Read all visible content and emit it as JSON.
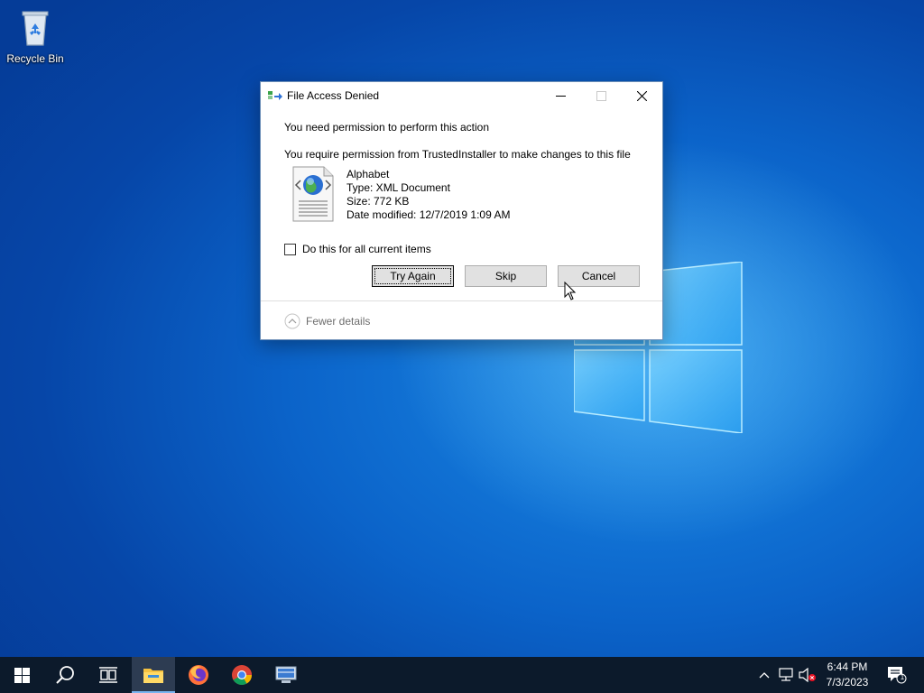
{
  "desktop": {
    "icons": [
      {
        "label": "Recycle Bin",
        "icon": "recycle-bin-icon"
      }
    ]
  },
  "dialog": {
    "title": "File Access Denied",
    "heading": "You need permission to perform this action",
    "message": "You require permission from TrustedInstaller to make changes to this file",
    "file": {
      "name": "Alphabet",
      "type": "Type: XML Document",
      "size": "Size: 772 KB",
      "modified": "Date modified: 12/7/2019 1:09 AM"
    },
    "checkbox_label": "Do this for all current items",
    "checkbox_checked": false,
    "buttons": {
      "try_again": "Try Again",
      "skip": "Skip",
      "cancel": "Cancel"
    },
    "details_toggle": "Fewer details"
  },
  "taskbar": {
    "apps": [
      {
        "name": "start",
        "icon": "windows-start-icon"
      },
      {
        "name": "search",
        "icon": "search-icon"
      },
      {
        "name": "task-view",
        "icon": "task-view-icon"
      },
      {
        "name": "file-explorer",
        "icon": "file-explorer-icon",
        "active": true
      },
      {
        "name": "firefox",
        "icon": "firefox-icon"
      },
      {
        "name": "chrome",
        "icon": "chrome-icon"
      },
      {
        "name": "network-tool",
        "icon": "computer-app-icon"
      }
    ],
    "tray": {
      "time": "6:44 PM",
      "date": "7/3/2023",
      "notification_count": "1"
    }
  },
  "colors": {
    "desktop_blue": "#0b63c9",
    "taskbar": "#0c1a2b",
    "dialog_border": "#6d8fb8"
  }
}
